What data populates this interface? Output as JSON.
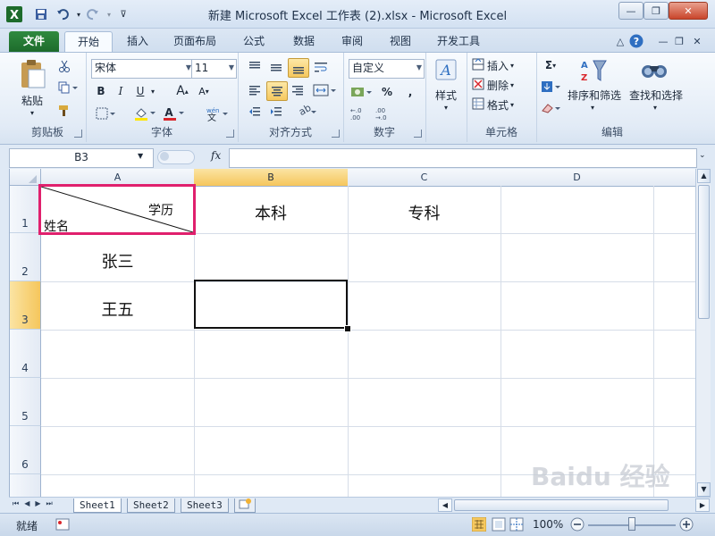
{
  "window": {
    "title": "新建 Microsoft Excel 工作表 (2).xlsx - Microsoft Excel"
  },
  "ribbon_tabs": [
    {
      "label": "文件"
    },
    {
      "label": "开始"
    },
    {
      "label": "插入"
    },
    {
      "label": "页面布局"
    },
    {
      "label": "公式"
    },
    {
      "label": "数据"
    },
    {
      "label": "审阅"
    },
    {
      "label": "视图"
    },
    {
      "label": "开发工具"
    }
  ],
  "ribbon": {
    "clipboard": {
      "label": "剪贴板",
      "paste_label": "粘贴"
    },
    "font": {
      "label": "字体",
      "font_name": "宋体",
      "font_size": "11"
    },
    "alignment": {
      "label": "对齐方式"
    },
    "number": {
      "label": "数字",
      "format": "自定义"
    },
    "styles": {
      "label": "样式"
    },
    "cells": {
      "label": "单元格",
      "insert_label": "插入",
      "delete_label": "删除",
      "format_label": "格式"
    },
    "editing": {
      "label": "编辑",
      "sort_filter_label": "排序和筛选",
      "find_select_label": "查找和选择"
    }
  },
  "formula_bar": {
    "name_box": "B3",
    "fx": "fx",
    "formula": ""
  },
  "columns": [
    "A",
    "B",
    "C",
    "D"
  ],
  "rows": [
    "1",
    "2",
    "3",
    "4",
    "5",
    "6"
  ],
  "cells": {
    "a1_top_right": "学历",
    "a1_bottom_left": "姓名",
    "b1": "本科",
    "c1": "专科",
    "a2": "张三",
    "a3": "王五"
  },
  "sheet_tabs": [
    "Sheet1",
    "Sheet2",
    "Sheet3"
  ],
  "status": {
    "ready": "就绪",
    "zoom": "100%"
  },
  "watermark": "Baidu 经验",
  "colors": {
    "file_tab": "#1d6b2b",
    "selected_header": "#f5c65c",
    "highlight_box": "#e0206d"
  }
}
